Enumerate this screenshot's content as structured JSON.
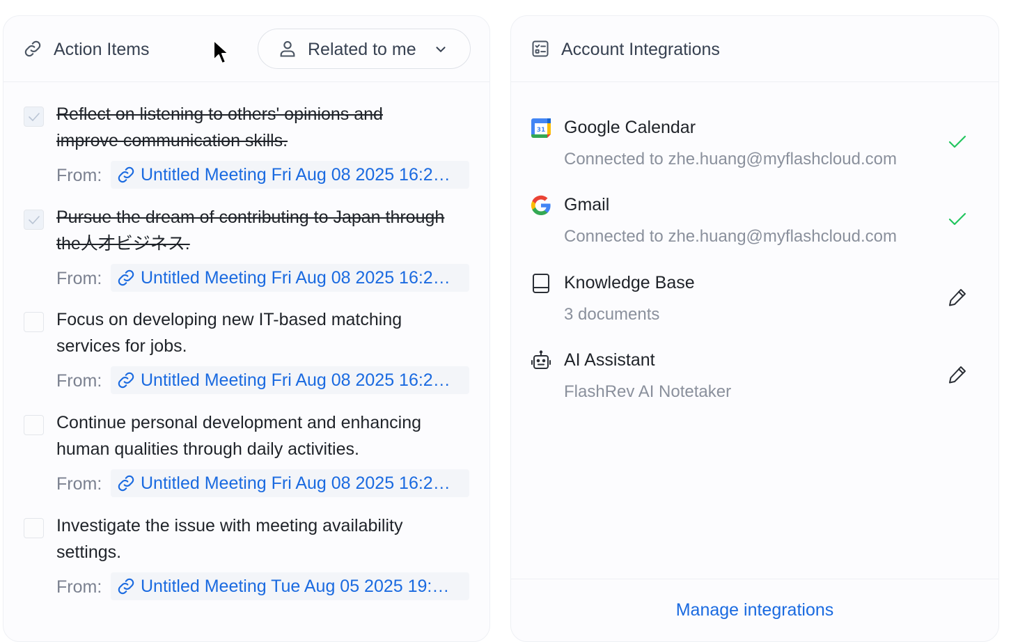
{
  "action_items_panel": {
    "title": "Action Items",
    "filter_label": "Related to me",
    "from_label": "From:",
    "items": [
      {
        "text_line1": "Reflect on listening to others' opinions and",
        "text_line2": "improve communication skills.",
        "done": true,
        "meeting": "Untitled Meeting Fri Aug 08 2025 16:2…"
      },
      {
        "text_line1": "Pursue the dream of contributing to Japan through",
        "text_line2": "the人才ビジネス.",
        "done": true,
        "meeting": "Untitled Meeting Fri Aug 08 2025 16:2…"
      },
      {
        "text_line1": "Focus on developing new IT-based matching",
        "text_line2": "services for jobs.",
        "done": false,
        "meeting": "Untitled Meeting Fri Aug 08 2025 16:2…"
      },
      {
        "text_line1": "Continue personal development and enhancing",
        "text_line2": "human qualities through daily activities.",
        "done": false,
        "meeting": "Untitled Meeting Fri Aug 08 2025 16:2…"
      },
      {
        "text_line1": "Investigate the issue with meeting availability",
        "text_line2": "settings.",
        "done": false,
        "meeting": "Untitled Meeting Tue Aug 05 2025 19:…"
      }
    ]
  },
  "integrations_panel": {
    "title": "Account Integrations",
    "items": [
      {
        "name": "Google Calendar",
        "desc": "Connected to zhe.huang@myflashcloud.com",
        "icon": "google-calendar-icon",
        "status": "connected"
      },
      {
        "name": "Gmail",
        "desc": "Connected to zhe.huang@myflashcloud.com",
        "icon": "gmail-icon",
        "status": "connected"
      },
      {
        "name": "Knowledge Base",
        "desc": "3 documents",
        "icon": "book-icon",
        "status": "editable"
      },
      {
        "name": "AI Assistant",
        "desc": "FlashRev AI Notetaker",
        "icon": "robot-icon",
        "status": "editable"
      }
    ],
    "manage_label": "Manage integrations"
  },
  "colors": {
    "accent_link": "#1a6ae0",
    "success_check": "#22c55e",
    "muted_text": "#8a909c"
  }
}
